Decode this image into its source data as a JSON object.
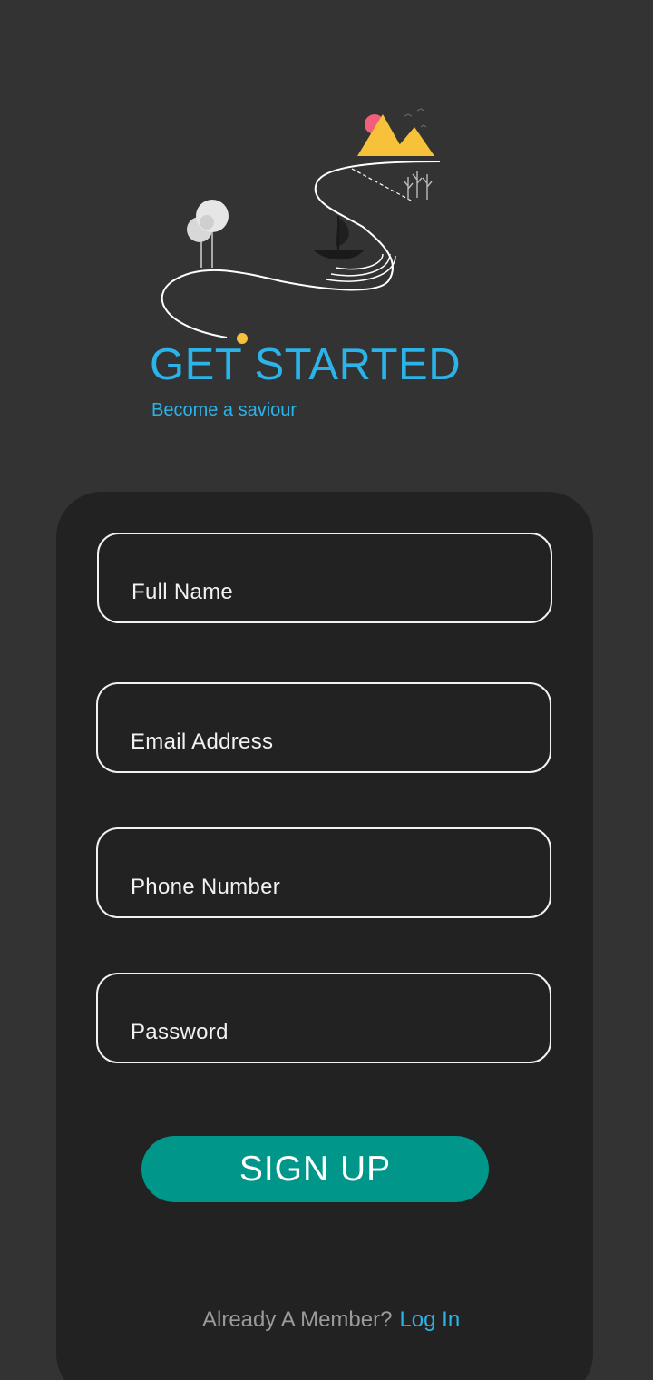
{
  "header": {
    "title": "GET STARTED",
    "subtitle": "Become a saviour"
  },
  "form": {
    "fields": [
      {
        "label": "Full Name"
      },
      {
        "label": "Email Address"
      },
      {
        "label": "Phone Number"
      },
      {
        "label": "Password"
      }
    ],
    "submit_label": "SIGN UP"
  },
  "footer": {
    "question": "Already A Member?",
    "login_label": "Log In"
  },
  "colors": {
    "background": "#333333",
    "card": "#222222",
    "accent_blue": "#2bb4ea",
    "button_teal": "#00968a",
    "sun_pink": "#f0607a",
    "mountain_yellow": "#f7c23a",
    "dot_yellow": "#f7c23a"
  },
  "icons": [
    "journey-illustration",
    "mountain-icon",
    "sun-icon",
    "tree-icon",
    "boat-icon",
    "bird-icon",
    "start-dot-icon"
  ]
}
